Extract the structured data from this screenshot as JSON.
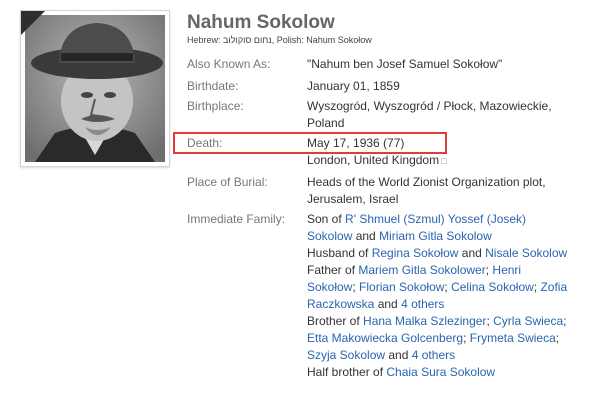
{
  "profile": {
    "name": "Nahum Sokolow",
    "names_line": "Hebrew: נחום סוקולוב, Polish: Nahum Sokołow",
    "photo_icon": "portrait-photo"
  },
  "facts": {
    "aka": {
      "label": "Also Known As:",
      "value": "\"Nahum ben Josef Samuel Sokołow\""
    },
    "birthdate": {
      "label": "Birthdate:",
      "value": "January 01, 1859"
    },
    "birthplace": {
      "label": "Birthplace:",
      "value": "Wyszogród, Wyszogród / Płock, Mazowieckie, Poland"
    },
    "death": {
      "label": "Death:",
      "value": "May 17, 1936 (77)",
      "place": "London, United Kingdom",
      "place_icon": "external-link-icon"
    },
    "burial": {
      "label": "Place of Burial:",
      "value": "Heads of the World Zionist Organization plot, Jerusalem, Israel"
    },
    "family_label": "Immediate Family:"
  },
  "family": {
    "son_of": {
      "prefix": "Son of ",
      "person1": "R' Shmuel (Szmul) Yossef (Josek) Sokolow",
      "and": " and ",
      "person2": "Miriam Gitla Sokolow"
    },
    "husband_of": {
      "prefix": "Husband of ",
      "person1": "Regina Sokołow",
      "and": " and ",
      "person2": "Nisale Sokolow"
    },
    "father_of": {
      "prefix": "Father of ",
      "p1": "Mariem Gitla Sokolower",
      "sep": "; ",
      "p2": "Henri Sokołow",
      "p3": "Florian Sokołow",
      "p4": "Celina Sokołow",
      "p5": "Zofia Raczkowska",
      "and": " and ",
      "more": "4 others"
    },
    "brother_of": {
      "prefix": "Brother of ",
      "p1": "Hana Malka Szlezinger",
      "sep": "; ",
      "p2": "Cyrla Swieca",
      "p3": "Etta Makowiecka Golcenberg",
      "p4": "Frymeta Swieca",
      "p5": "Szyja Sokolow",
      "and": " and ",
      "more": "4 others"
    },
    "half_brother_of": {
      "prefix": "Half brother of ",
      "p1": "Chaia Sura Sokolow"
    }
  },
  "colors": {
    "link": "#2a65b0",
    "highlight": "#e43a3a",
    "label": "#777777"
  }
}
